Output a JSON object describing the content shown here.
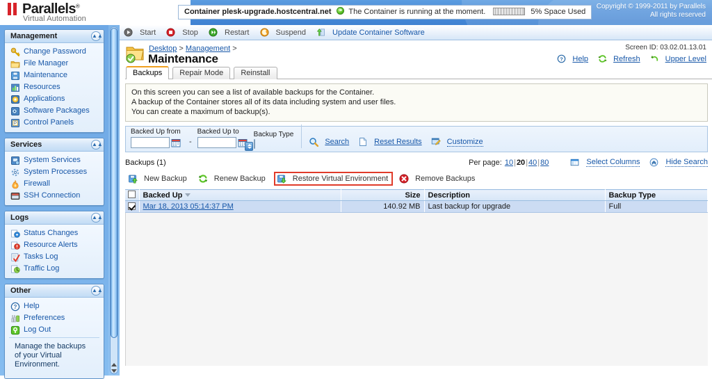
{
  "header": {
    "brand_name": "Parallels",
    "brand_tm": "®",
    "brand_sub": "Virtual Automation",
    "container_label": "Container plesk-upgrade.hostcentral.net",
    "container_state": "The Container is running at the moment.",
    "space_used": "5% Space Used",
    "copyright_line1": "Copyright © 1999-2011 by Parallels",
    "copyright_line2": "All rights reserved"
  },
  "sidebar": {
    "sections": [
      {
        "title": "Management",
        "items": [
          {
            "label": "Change Password",
            "icon": "key-icon"
          },
          {
            "label": "File Manager",
            "icon": "folder-icon"
          },
          {
            "label": "Maintenance",
            "icon": "disk-icon"
          },
          {
            "label": "Resources",
            "icon": "bar-chart-icon"
          },
          {
            "label": "Applications",
            "icon": "applications-icon"
          },
          {
            "label": "Software Packages",
            "icon": "package-icon"
          },
          {
            "label": "Control Panels",
            "icon": "control-panel-icon"
          }
        ]
      },
      {
        "title": "Services",
        "items": [
          {
            "label": "System Services",
            "icon": "services-icon"
          },
          {
            "label": "System Processes",
            "icon": "processes-icon"
          },
          {
            "label": "Firewall",
            "icon": "firewall-icon"
          },
          {
            "label": "SSH Connection",
            "icon": "terminal-icon"
          }
        ]
      },
      {
        "title": "Logs",
        "items": [
          {
            "label": "Status Changes",
            "icon": "status-changes-icon"
          },
          {
            "label": "Resource Alerts",
            "icon": "alert-icon"
          },
          {
            "label": "Tasks Log",
            "icon": "tasks-icon"
          },
          {
            "label": "Traffic Log",
            "icon": "traffic-icon"
          }
        ]
      },
      {
        "title": "Other",
        "items": [
          {
            "label": "Help",
            "icon": "help-icon"
          },
          {
            "label": "Preferences",
            "icon": "preferences-icon"
          },
          {
            "label": "Log Out",
            "icon": "logout-icon"
          }
        ]
      }
    ],
    "note": "Manage the backups of your Virtual Environment."
  },
  "toolbar": {
    "items": [
      {
        "label": "Start",
        "icon": "play-icon"
      },
      {
        "label": "Stop",
        "icon": "stop-icon"
      },
      {
        "label": "Restart",
        "icon": "restart-icon"
      },
      {
        "label": "Suspend",
        "icon": "suspend-icon"
      },
      {
        "label": "Update Container Software",
        "icon": "update-icon"
      }
    ]
  },
  "page": {
    "breadcrumb_1": "Desktop",
    "breadcrumb_sep": ">",
    "breadcrumb_2": "Management",
    "breadcrumb_tail": ">",
    "title": "Maintenance",
    "screen_id": "Screen ID: 03.02.01.13.01",
    "tools": [
      {
        "label": "Help",
        "icon": "help-icon"
      },
      {
        "label": "Refresh",
        "icon": "refresh-icon"
      },
      {
        "label": "Upper Level",
        "icon": "upper-level-icon"
      }
    ],
    "tabs": [
      {
        "label": "Backups",
        "active": true
      },
      {
        "label": "Repair Mode",
        "active": false
      },
      {
        "label": "Reinstall",
        "active": false
      }
    ],
    "info_line1": "On this screen you can see a list of available backups for the Container.",
    "info_line2": "A backup of the Container stores all of its data including system and user files.",
    "info_line3": "You can create a maximum of backup(s)."
  },
  "search": {
    "from_label": "Backed Up from",
    "from_value": "",
    "to_label": "Backed Up to",
    "to_value": "",
    "type_label": "Backup Type",
    "type_value": "",
    "dash": "-",
    "search_label": "Search",
    "reset_label": "Reset Results",
    "customize_label": "Customize"
  },
  "list": {
    "count_label": "Backups (1)",
    "per_page_label": "Per page:",
    "per_page_options": [
      "10",
      "20",
      "40",
      "80"
    ],
    "per_page_selected": "20",
    "select_columns_label": "Select Columns",
    "hide_search_label": "Hide Search"
  },
  "actions": [
    {
      "label": "New Backup",
      "icon": "new-backup-icon",
      "highlighted": false
    },
    {
      "label": "Renew Backup",
      "icon": "renew-backup-icon",
      "highlighted": false
    },
    {
      "label": "Restore Virtual Environment",
      "icon": "restore-icon",
      "highlighted": true
    },
    {
      "label": "Remove Backups",
      "icon": "remove-icon",
      "highlighted": false
    }
  ],
  "table": {
    "columns": [
      "Backed Up",
      "Size",
      "Description",
      "Backup Type"
    ],
    "sorted_by": "Backed Up",
    "rows": [
      {
        "checked": true,
        "backed_up": "Mar 18, 2013 05:14:37 PM",
        "size": "140.92 MB",
        "description": "Last backup for upgrade",
        "backup_type": "Full"
      }
    ]
  },
  "colors": {
    "accent_blue": "#1757a8",
    "header_blue": "#4a8cd8",
    "highlight_red": "#e03b2a",
    "tab_active_orange": "#f0a020",
    "row_blue": "#ccdcf3"
  }
}
